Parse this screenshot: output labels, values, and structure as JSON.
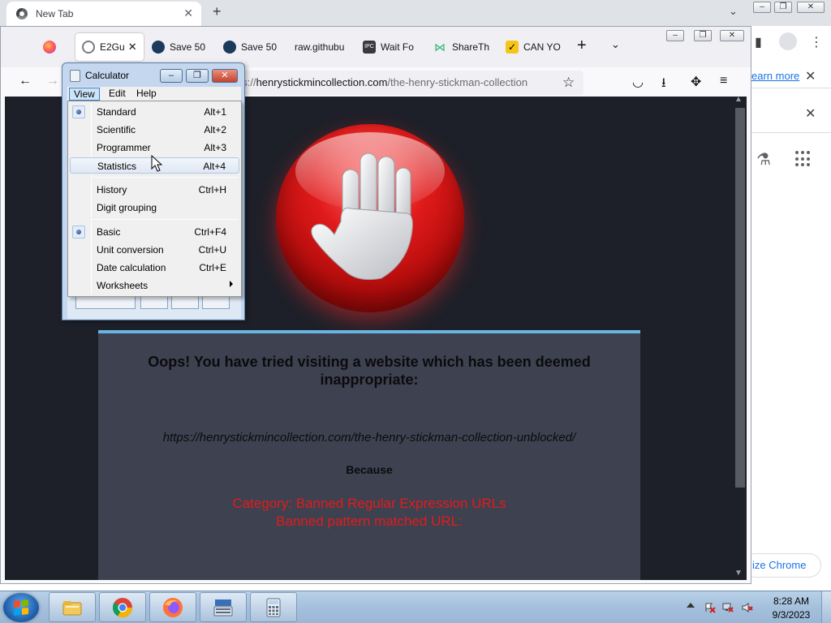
{
  "chrome": {
    "tab_title": "New Tab",
    "learn_more": "earn more",
    "customize": "ize Chrome"
  },
  "firefox": {
    "tabs": [
      {
        "label": "E2Gu",
        "color": "#7a7a80"
      },
      {
        "label": "Save 50",
        "color": "#1b3a5c"
      },
      {
        "label": "Save 50",
        "color": "#1b3a5c"
      },
      {
        "label": "raw.githubu",
        "color": "#ffffff"
      },
      {
        "label": "Wait Fo",
        "color": "#3a3a3a"
      },
      {
        "label": "ShareTh",
        "color": "#2bb673"
      },
      {
        "label": "CAN YO",
        "color": "#f5c518"
      }
    ],
    "url_prefix": "ps://",
    "url_domain": "henrystickmincollection.com",
    "url_path": "/the-henry-stickman-collection"
  },
  "blocked_page": {
    "title": "Oops! You have tried visiting a website which has been deemed inappropriate:",
    "url": "https://henrystickmincollection.com/the-henry-stickman-collection-unblocked/",
    "because": "Because",
    "category": "Category: Banned Regular Expression URLs",
    "pattern": "Banned pattern matched URL:"
  },
  "calculator": {
    "title": "Calculator",
    "menus": [
      "View",
      "Edit",
      "Help"
    ],
    "view_menu": [
      {
        "label": "Standard",
        "shortcut": "Alt+1",
        "checked": true
      },
      {
        "label": "Scientific",
        "shortcut": "Alt+2",
        "checked": false
      },
      {
        "label": "Programmer",
        "shortcut": "Alt+3",
        "checked": false
      },
      {
        "label": "Statistics",
        "shortcut": "Alt+4",
        "checked": false,
        "hover": true
      },
      {
        "label": "History",
        "shortcut": "Ctrl+H",
        "checked": false
      },
      {
        "label": "Digit grouping",
        "shortcut": "",
        "checked": false
      },
      {
        "label": "Basic",
        "shortcut": "Ctrl+F4",
        "checked": true
      },
      {
        "label": "Unit conversion",
        "shortcut": "Ctrl+U",
        "checked": false
      },
      {
        "label": "Date calculation",
        "shortcut": "Ctrl+E",
        "checked": false
      },
      {
        "label": "Worksheets",
        "shortcut": "",
        "checked": false,
        "submenu": true
      }
    ]
  },
  "taskbar": {
    "time": "8:28 AM",
    "date": "9/3/2023"
  },
  "colors": {
    "page_bg": "#1d2029",
    "card_bg": "#3e414f",
    "card_accent": "#6ab4e2",
    "category_red": "#e31b1b"
  }
}
